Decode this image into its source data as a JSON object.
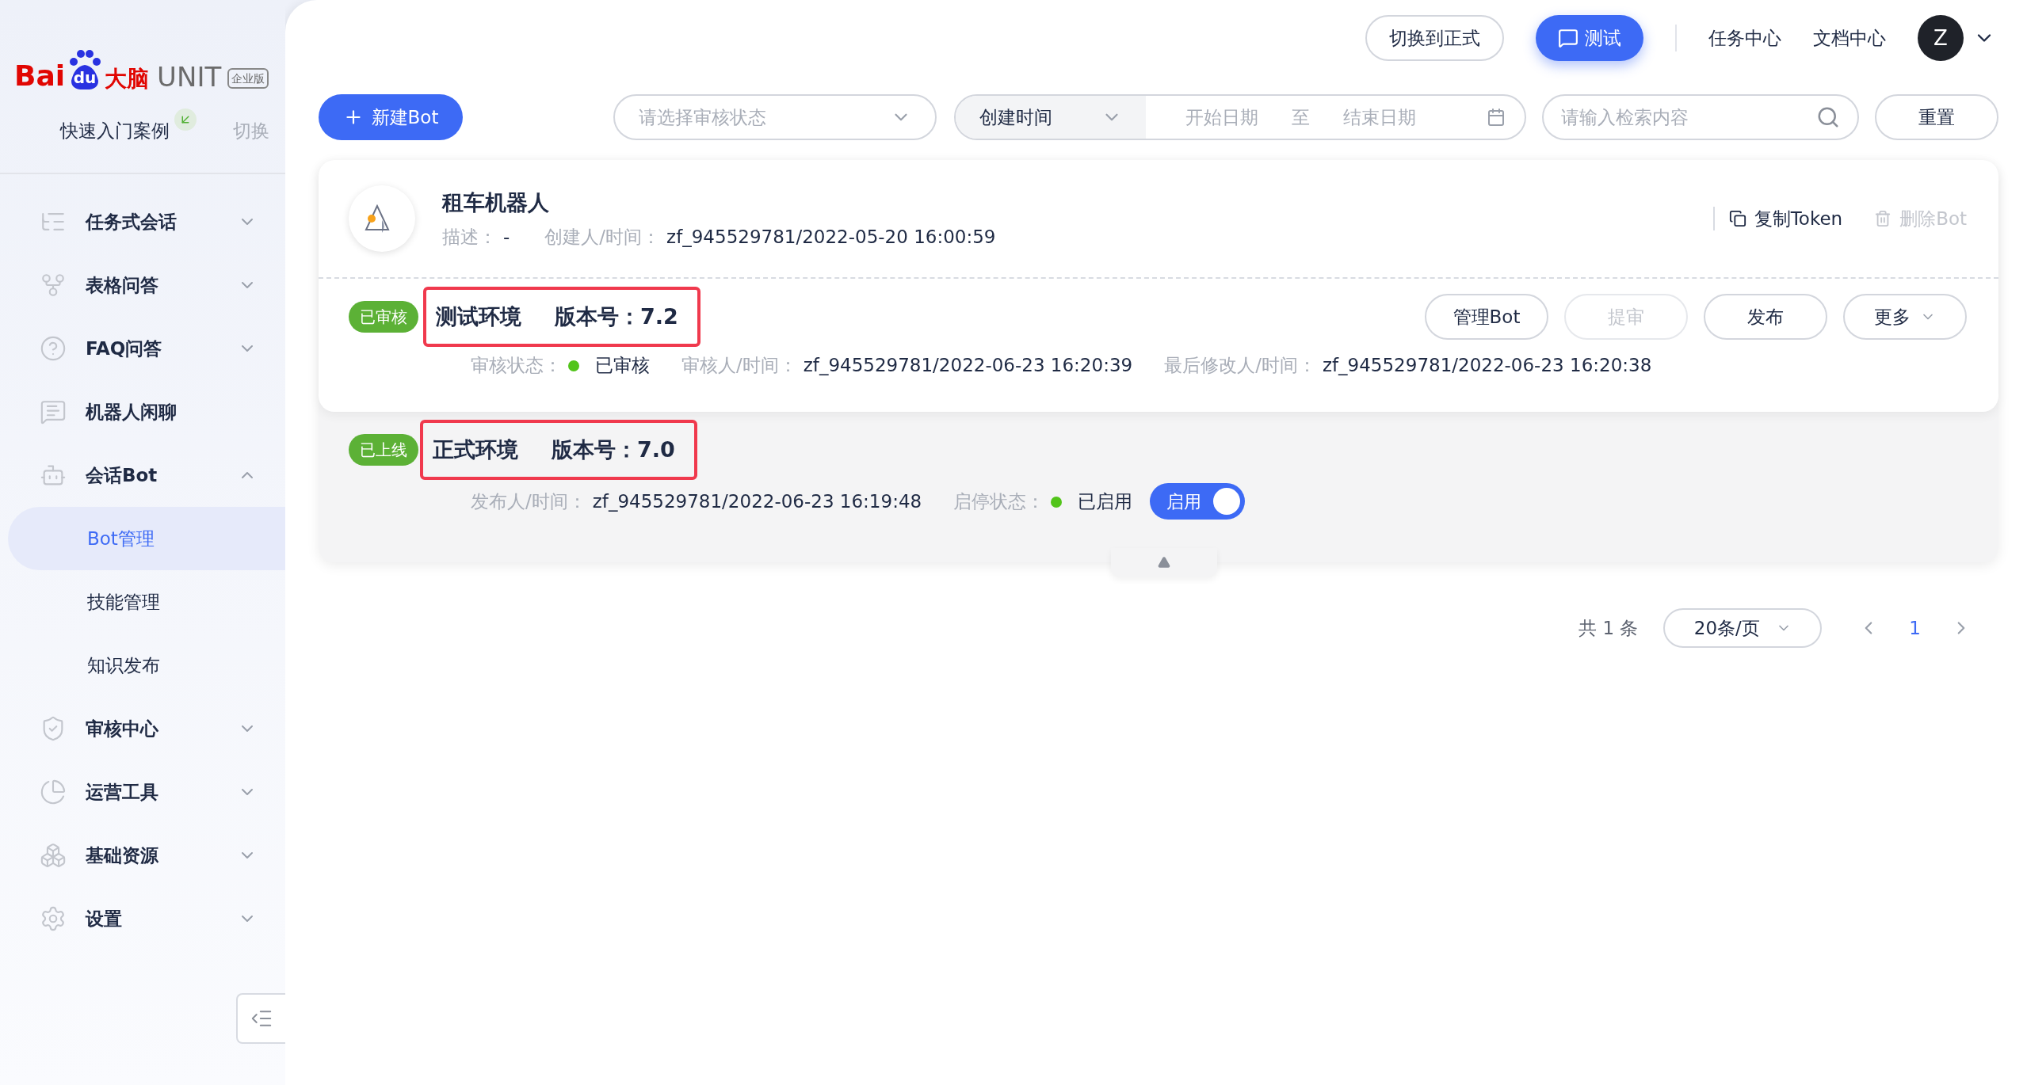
{
  "sidebar": {
    "logo": {
      "brand": "Bai",
      "paw": "du",
      "product_cn": "大脑",
      "product": "UNIT",
      "edition": "企业版"
    },
    "quick_start": {
      "label": "快速入门案例",
      "action": "切换"
    },
    "items": [
      {
        "label": "任务式会话",
        "kind": "group",
        "expanded": false
      },
      {
        "label": "表格问答",
        "kind": "group",
        "expanded": false
      },
      {
        "label": "FAQ问答",
        "kind": "group",
        "expanded": false
      },
      {
        "label": "机器人闲聊",
        "kind": "link"
      },
      {
        "label": "会话Bot",
        "kind": "group",
        "expanded": true,
        "children": [
          {
            "label": "Bot管理",
            "selected": true
          },
          {
            "label": "技能管理",
            "selected": false
          },
          {
            "label": "知识发布",
            "selected": false
          }
        ]
      },
      {
        "label": "审核中心",
        "kind": "group",
        "expanded": false
      },
      {
        "label": "运营工具",
        "kind": "group",
        "expanded": false
      },
      {
        "label": "基础资源",
        "kind": "group",
        "expanded": false
      },
      {
        "label": "设置",
        "kind": "group",
        "expanded": false
      }
    ]
  },
  "header": {
    "buttons": [
      {
        "label": "切换到正式",
        "kind": "outline"
      },
      {
        "label": "测试",
        "kind": "primary"
      }
    ],
    "links": [
      "任务中心",
      "文档中心"
    ],
    "avatar": "Z"
  },
  "toolbar": {
    "new_button": "新建Bot",
    "status_select": {
      "placeholder": "请选择审核状态"
    },
    "time_select": "创建时间",
    "start_date": {
      "placeholder": "开始日期"
    },
    "range_separator": "至",
    "end_date": {
      "placeholder": "结束日期"
    },
    "search": {
      "placeholder": "请输入检索内容"
    },
    "reset": "重置"
  },
  "bot": {
    "name": "租车机器人",
    "description_label": "描述：",
    "description": "-",
    "creator_label": "创建人/时间：",
    "creator": "zf_945529781/2022-05-20 16:00:59",
    "actions": [
      {
        "label": "复制Token",
        "disabled": false
      },
      {
        "label": "删除Bot",
        "disabled": true
      }
    ],
    "test_env": {
      "badge": "已审核",
      "title": "测试环境",
      "version_label": "版本号：",
      "version": "7.2",
      "highlighted": true,
      "buttons": [
        {
          "label": "管理Bot",
          "disabled": false,
          "kind": "plain"
        },
        {
          "label": "提审",
          "disabled": true,
          "kind": "plain"
        },
        {
          "label": "发布",
          "disabled": false,
          "kind": "plain"
        },
        {
          "label": "更多",
          "disabled": false,
          "kind": "dropdown"
        }
      ],
      "status_label": "审核状态：",
      "status": "已审核",
      "status_dot": {
        "color": "#52c41a"
      },
      "reviewer_label": "审核人/时间：",
      "reviewer": "zf_945529781/2022-06-23 16:20:39",
      "modifier_label": "最后修改人/时间：",
      "modifier": "zf_945529781/2022-06-23 16:20:38"
    },
    "prod_env": {
      "badge": "已上线",
      "title": "正式环境",
      "version_label": "版本号：",
      "version": "7.0",
      "highlighted": true,
      "publisher_label": "发布人/时间：",
      "publisher": "zf_945529781/2022-06-23 16:19:48",
      "state_label": "启停状态：",
      "state": "已启用",
      "state_dot": {
        "color": "#52c41a"
      },
      "toggle": {
        "label": "启用",
        "on": true
      }
    }
  },
  "pagination": {
    "total": "共 1 条",
    "page_size": "20条/页",
    "pages": [
      {
        "label": "1",
        "selected": true
      }
    ]
  }
}
